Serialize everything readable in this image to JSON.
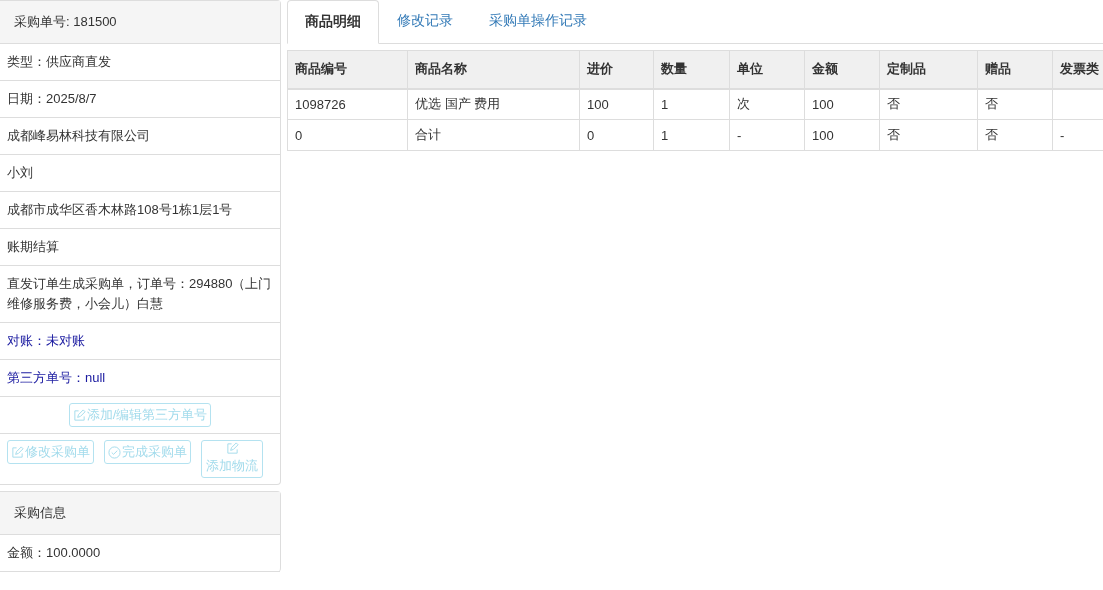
{
  "order_panel": {
    "title": "采购单号: 181500",
    "rows": [
      {
        "kind": "plain",
        "text": "类型：供应商直发"
      },
      {
        "kind": "plain",
        "text": "日期：2025/8/7"
      },
      {
        "kind": "plain",
        "text": "成都峰易林科技有限公司"
      },
      {
        "kind": "plain",
        "text": "小刘"
      },
      {
        "kind": "plain",
        "text": "成都市成华区香木林路108号1栋1层1号"
      },
      {
        "kind": "plain",
        "text": "账期结算"
      },
      {
        "kind": "plain",
        "text": "直发订单生成采购单，订单号：294880（上门维修服务费，小会儿）白慧"
      },
      {
        "kind": "highlight",
        "text": "对账：未对账"
      },
      {
        "kind": "highlight",
        "text": "第三方单号：null"
      }
    ],
    "third_party_button": {
      "label": "添加/编辑第三方单号",
      "disabled": true
    },
    "buttons": [
      {
        "label": "修改采购单",
        "kind": "edit",
        "disabled": true
      },
      {
        "label": "完成采购单",
        "kind": "complete",
        "disabled": true
      },
      {
        "label": "添加物流",
        "kind": "edit",
        "disabled": true
      }
    ]
  },
  "purchase_panel": {
    "title": "采购信息",
    "rows": [
      {
        "text": "金额：100.0000"
      }
    ]
  },
  "tabs": [
    {
      "label": "商品明细",
      "selected": true
    },
    {
      "label": "修改记录",
      "selected": false
    },
    {
      "label": "采购单操作记录",
      "selected": false
    }
  ],
  "table": {
    "columns": [
      "商品编号",
      "商品名称",
      "进价",
      "数量",
      "单位",
      "金额",
      "定制品",
      "赠品",
      "发票类"
    ],
    "rows": [
      [
        "1098726",
        "优选 国产 费用",
        "100",
        "1",
        "次",
        "100",
        "否",
        "否",
        ""
      ],
      [
        "0",
        "合计",
        "0",
        "1",
        "-",
        "100",
        "否",
        "否",
        "-"
      ]
    ]
  }
}
